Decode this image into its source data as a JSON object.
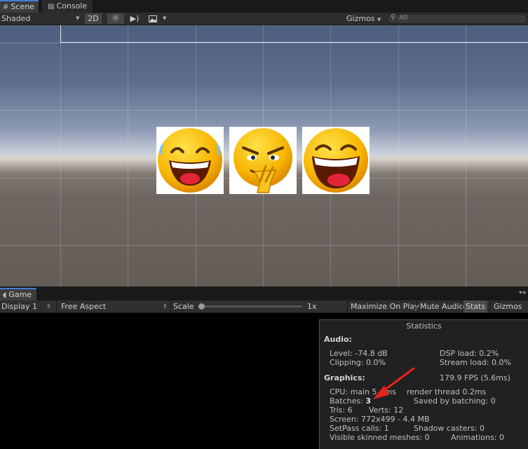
{
  "scene_tabs": {
    "scene_label": "Scene",
    "scene_icon": "hash-grid-icon",
    "console_label": "Console",
    "console_icon": "console-icon"
  },
  "scene_toolbar": {
    "draw_mode": "Shaded",
    "mode_2d": "2D",
    "lighting_icon": "sun-icon",
    "audio_icon": "speaker-icon",
    "effects_icon": "image-icon",
    "gizmos_label": "Gizmos",
    "search_placeholder": "All"
  },
  "scene_view": {
    "sprites": [
      "laughing-emoji",
      "mischievous-emoji",
      "grinning-emoji"
    ]
  },
  "game_tab": {
    "label": "Game",
    "icon": "pacman-icon"
  },
  "game_toolbar": {
    "display": "Display 1",
    "aspect": "Free Aspect",
    "scale_label": "Scale",
    "scale_value": "1x",
    "scale_fraction": 0.0,
    "maximize_on_play": "Maximize On Play",
    "mute_audio": "Mute Audio",
    "stats": "Stats",
    "gizmos": "Gizmos"
  },
  "statistics": {
    "title": "Statistics",
    "audio_header": "Audio:",
    "level": "Level: -74.8 dB",
    "clipping": "Clipping: 0.0%",
    "dsp_load": "DSP load: 0.2%",
    "stream_load": "Stream load: 0.0%",
    "graphics_header": "Graphics:",
    "fps": "179.9 FPS (5.6ms)",
    "cpu_main_prefix": "CPU: main 5",
    "cpu_main_suffix": "ms",
    "render_thread": "render thread 0.2ms",
    "batches_prefix": "Batches: ",
    "batches_value": "3",
    "saved_by_batching": "Saved by batching: 0",
    "tris": "Tris: 6",
    "verts": "Verts: 12",
    "screen": "Screen: 772x499 - 4.4 MB",
    "setpass": "SetPass calls: 1",
    "shadow_casters": "Shadow casters: 0",
    "visible_skinned": "Visible skinned meshes: 0",
    "animations": "Animations: 0"
  },
  "colors": {
    "annotation_arrow": "#e8231b",
    "tab_accent": "#3e7fd6",
    "emoji_yellow": "#f7b500"
  }
}
